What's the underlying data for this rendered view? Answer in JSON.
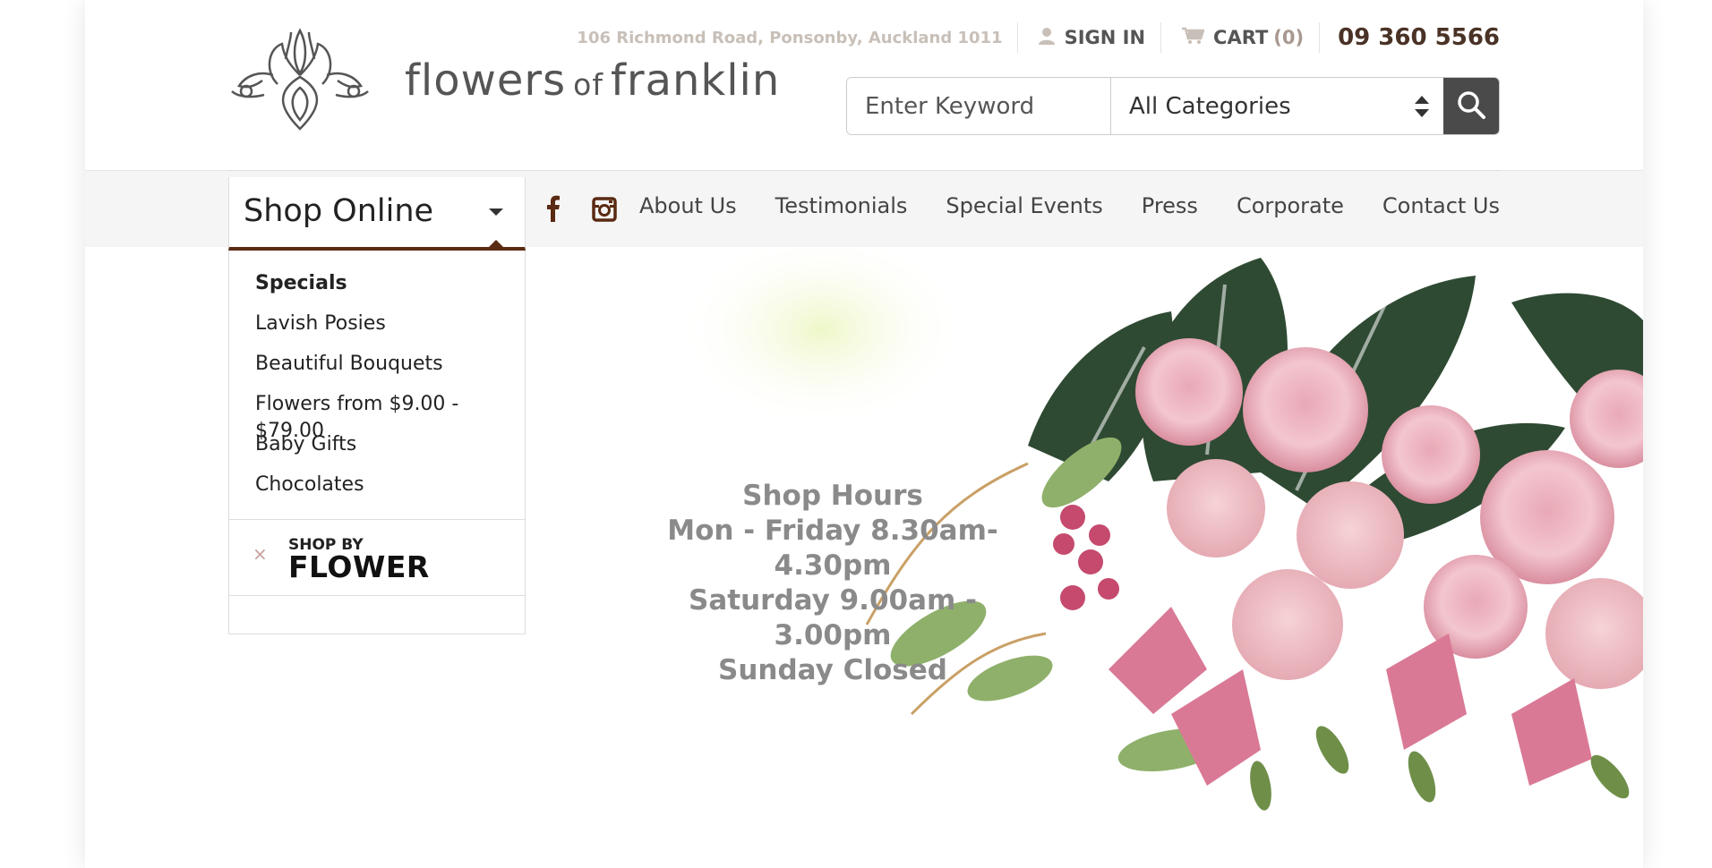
{
  "brand": {
    "name_part1": "flowers",
    "name_of": "of",
    "name_part2": "franklin"
  },
  "topbar": {
    "address": "106 Richmond Road, Ponsonby, Auckland 1011",
    "sign_in": "SIGN IN",
    "cart_label": "CART",
    "cart_count": "(0)",
    "phone": "09 360 5566"
  },
  "search": {
    "placeholder": "Enter Keyword",
    "category_selected": "All Categories"
  },
  "nav": {
    "shop_online": "Shop Online",
    "links": [
      "About Us",
      "Testimonials",
      "Special Events",
      "Press",
      "Corporate",
      "Contact Us"
    ]
  },
  "dropdown": {
    "items": [
      "Specials",
      "Lavish Posies",
      "Beautiful Bouquets",
      "Flowers from $9.00 - $79.00",
      "Baby Gifts",
      "Chocolates"
    ],
    "shop_by_small": "SHOP BY",
    "shop_by_big": "FLOWER",
    "close_symbol": "×"
  },
  "hero": {
    "hours_title": "Shop Hours",
    "hours_line1": "Mon - Friday 8.30am- 4.30pm",
    "hours_line2": "Saturday 9.00am - 3.00pm",
    "hours_line3": "Sunday Closed"
  },
  "colors": {
    "accent": "#5a2a12",
    "phone": "#4a3226",
    "search_button": "#4a4a4a"
  }
}
